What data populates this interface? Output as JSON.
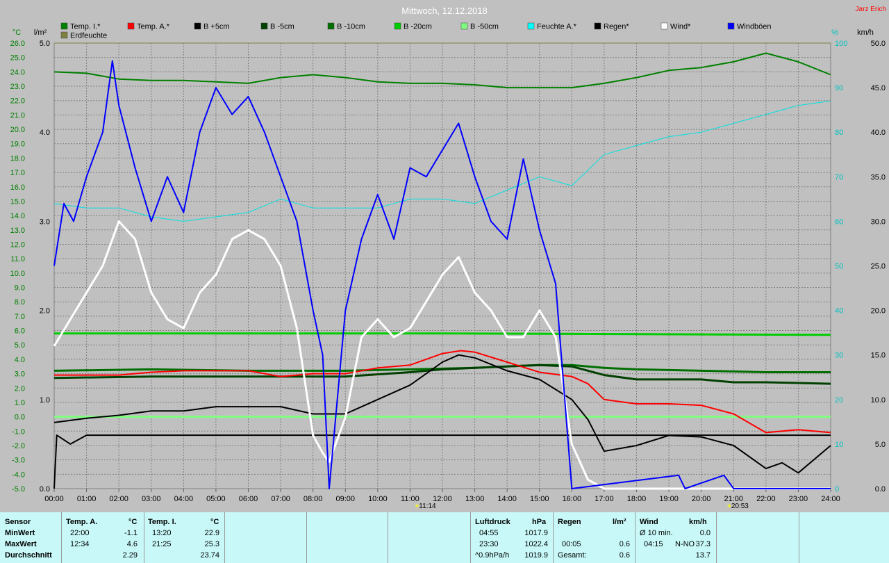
{
  "header": {
    "title": "Mittwoch, 12.12.2018",
    "author": "Jarz Erich"
  },
  "colors": {
    "temp_i": "#008000",
    "temp_a": "#ff0000",
    "b5": "#000000",
    "b_5": "#004000",
    "b_10": "#006f00",
    "b_20": "#00cc00",
    "b_50": "#80ff80",
    "feuchte": "#00e0e0",
    "regen": "#000000",
    "wind": "#ffffff",
    "windboeen": "#0000ff",
    "erdfeuchte": "#808040",
    "left_axis": "#008000",
    "right_axis": "#00c0c0",
    "grid": "#808080",
    "bg": "#c0c0c0"
  },
  "legend": [
    {
      "label": "Temp. I.*",
      "color": "#008000"
    },
    {
      "label": "Temp. A.*",
      "color": "#ff0000"
    },
    {
      "label": "B +5cm",
      "color": "#000000"
    },
    {
      "label": "B -5cm",
      "color": "#004000"
    },
    {
      "label": "B -10cm",
      "color": "#006f00"
    },
    {
      "label": "B -20cm",
      "color": "#00cc00"
    },
    {
      "label": "B -50cm",
      "color": "#80ff80"
    },
    {
      "label": "Feuchte A.*",
      "color": "#00ffff"
    },
    {
      "label": "Regen*",
      "color": "#000000"
    },
    {
      "label": "Wind*",
      "color": "#ffffff"
    },
    {
      "label": "Windböen",
      "color": "#0000ff"
    },
    {
      "label": "Erdfeuchte",
      "color": "#808040"
    }
  ],
  "axes": {
    "left_unit": "°C",
    "rain_unit": "l/m²",
    "hum_unit": "%",
    "wind_unit": "km/h",
    "temp_ticks": [
      "26.0",
      "25.0",
      "24.0",
      "23.0",
      "22.0",
      "21.0",
      "20.0",
      "19.0",
      "18.0",
      "17.0",
      "16.0",
      "15.0",
      "14.0",
      "13.0",
      "12.0",
      "11.0",
      "10.0",
      "9.0",
      "8.0",
      "7.0",
      "6.0",
      "5.0",
      "4.0",
      "3.0",
      "2.0",
      "1.0",
      "0.0",
      "-1.0",
      "-2.0",
      "-3.0",
      "-4.0",
      "-5.0"
    ],
    "rain_ticks": [
      "5.0",
      "4.0",
      "3.0",
      "2.0",
      "1.0",
      "0.0"
    ],
    "hum_ticks": [
      "100",
      "90",
      "80",
      "70",
      "60",
      "50",
      "40",
      "30",
      "20",
      "10",
      "0"
    ],
    "wind_ticks": [
      "50.0",
      "45.0",
      "40.0",
      "35.0",
      "30.0",
      "25.0",
      "20.0",
      "15.0",
      "10.0",
      "5.0",
      "0.0"
    ],
    "time_ticks": [
      "00:00",
      "01:00",
      "02:00",
      "03:00",
      "04:00",
      "05:00",
      "06:00",
      "07:00",
      "08:00",
      "09:00",
      "10:00",
      "11:00",
      "12:00",
      "13:00",
      "14:00",
      "15:00",
      "16:00",
      "17:00",
      "18:00",
      "19:00",
      "20:00",
      "21:00",
      "22:00",
      "23:00",
      "24:00"
    ],
    "sunrise": "11:14",
    "sunset": "20:53"
  },
  "chart_data": {
    "type": "line",
    "title": "Mittwoch, 12.12.2018",
    "x_range_hours": [
      0,
      24
    ],
    "ylim_temp": [
      -5,
      26
    ],
    "ylim_rain": [
      0,
      5
    ],
    "ylim_hum": [
      0,
      100
    ],
    "ylim_wind": [
      0,
      50
    ],
    "series": [
      {
        "name": "Temp. I.*",
        "axis": "temp",
        "points": [
          [
            0,
            24.0
          ],
          [
            1,
            23.9
          ],
          [
            2,
            23.5
          ],
          [
            3,
            23.4
          ],
          [
            4,
            23.4
          ],
          [
            5,
            23.3
          ],
          [
            6,
            23.2
          ],
          [
            7,
            23.6
          ],
          [
            8,
            23.8
          ],
          [
            9,
            23.6
          ],
          [
            10,
            23.3
          ],
          [
            11,
            23.2
          ],
          [
            12,
            23.2
          ],
          [
            13,
            23.1
          ],
          [
            14,
            22.9
          ],
          [
            15,
            22.9
          ],
          [
            16,
            22.9
          ],
          [
            17,
            23.2
          ],
          [
            18,
            23.6
          ],
          [
            19,
            24.1
          ],
          [
            20,
            24.3
          ],
          [
            21,
            24.7
          ],
          [
            22,
            25.3
          ],
          [
            23,
            24.7
          ],
          [
            24,
            23.8
          ]
        ]
      },
      {
        "name": "Temp. A.*",
        "axis": "temp",
        "points": [
          [
            0,
            2.9
          ],
          [
            1,
            2.9
          ],
          [
            2,
            2.9
          ],
          [
            3,
            3.1
          ],
          [
            4,
            3.2
          ],
          [
            5,
            3.2
          ],
          [
            6,
            3.2
          ],
          [
            7,
            2.8
          ],
          [
            8,
            3.0
          ],
          [
            9,
            3.0
          ],
          [
            10,
            3.4
          ],
          [
            11,
            3.6
          ],
          [
            12,
            4.4
          ],
          [
            12.57,
            4.6
          ],
          [
            13,
            4.5
          ],
          [
            14,
            3.8
          ],
          [
            15,
            3.1
          ],
          [
            16,
            2.8
          ],
          [
            16.5,
            2.3
          ],
          [
            17,
            1.2
          ],
          [
            18,
            0.9
          ],
          [
            19,
            0.9
          ],
          [
            20,
            0.8
          ],
          [
            21,
            0.2
          ],
          [
            22,
            -1.1
          ],
          [
            23,
            -0.9
          ],
          [
            24,
            -1.1
          ]
        ]
      },
      {
        "name": "B +5cm",
        "axis": "temp",
        "points": [
          [
            0,
            -0.4
          ],
          [
            1,
            -0.1
          ],
          [
            2,
            0.1
          ],
          [
            3,
            0.4
          ],
          [
            4,
            0.4
          ],
          [
            5,
            0.7
          ],
          [
            6,
            0.7
          ],
          [
            7,
            0.7
          ],
          [
            8,
            0.2
          ],
          [
            9,
            0.2
          ],
          [
            10,
            1.2
          ],
          [
            11,
            2.2
          ],
          [
            12,
            3.8
          ],
          [
            12.5,
            4.3
          ],
          [
            13,
            4.1
          ],
          [
            14,
            3.2
          ],
          [
            15,
            2.6
          ],
          [
            16,
            1.2
          ],
          [
            16.5,
            -0.2
          ],
          [
            17,
            -2.4
          ],
          [
            18,
            -2.0
          ],
          [
            19,
            -1.3
          ],
          [
            20,
            -1.4
          ],
          [
            21,
            -2.0
          ],
          [
            22,
            -3.6
          ],
          [
            22.5,
            -3.2
          ],
          [
            23,
            -3.9
          ],
          [
            24,
            -2.0
          ]
        ]
      },
      {
        "name": "B -5cm",
        "axis": "temp",
        "points": [
          [
            0,
            2.7
          ],
          [
            3,
            2.8
          ],
          [
            6,
            2.8
          ],
          [
            9,
            2.8
          ],
          [
            11,
            3.1
          ],
          [
            12,
            3.3
          ],
          [
            13,
            3.4
          ],
          [
            15,
            3.6
          ],
          [
            16,
            3.5
          ],
          [
            17,
            2.9
          ],
          [
            18,
            2.6
          ],
          [
            19,
            2.6
          ],
          [
            20,
            2.6
          ],
          [
            21,
            2.4
          ],
          [
            22,
            2.4
          ],
          [
            24,
            2.3
          ]
        ]
      },
      {
        "name": "B -10cm",
        "axis": "temp",
        "points": [
          [
            0,
            3.2
          ],
          [
            3,
            3.3
          ],
          [
            6,
            3.2
          ],
          [
            9,
            3.2
          ],
          [
            11,
            3.3
          ],
          [
            13,
            3.4
          ],
          [
            15,
            3.6
          ],
          [
            16,
            3.6
          ],
          [
            17,
            3.4
          ],
          [
            18,
            3.3
          ],
          [
            20,
            3.2
          ],
          [
            22,
            3.1
          ],
          [
            24,
            3.1
          ]
        ]
      },
      {
        "name": "B -20cm",
        "axis": "temp",
        "points": [
          [
            0,
            5.8
          ],
          [
            12,
            5.8
          ],
          [
            24,
            5.7
          ]
        ]
      },
      {
        "name": "B -50cm",
        "axis": "temp",
        "points": [
          [
            0,
            0.0
          ],
          [
            24,
            0.0
          ]
        ]
      },
      {
        "name": "Feuchte A.*",
        "axis": "hum",
        "points": [
          [
            0,
            64
          ],
          [
            1,
            63
          ],
          [
            2,
            63
          ],
          [
            3,
            61
          ],
          [
            4,
            60
          ],
          [
            5,
            61
          ],
          [
            6,
            62
          ],
          [
            7,
            65
          ],
          [
            8,
            63
          ],
          [
            9,
            63
          ],
          [
            10,
            63
          ],
          [
            11,
            65
          ],
          [
            12,
            65
          ],
          [
            13,
            64
          ],
          [
            14,
            67
          ],
          [
            15,
            70
          ],
          [
            16,
            68
          ],
          [
            17,
            75
          ],
          [
            18,
            77
          ],
          [
            19,
            79
          ],
          [
            20,
            80
          ],
          [
            21,
            82
          ],
          [
            22,
            84
          ],
          [
            23,
            86
          ],
          [
            24,
            87
          ]
        ]
      },
      {
        "name": "Regen*",
        "axis": "rain",
        "points": [
          [
            0,
            0.0
          ],
          [
            0.08,
            0.6
          ],
          [
            0.5,
            0.5
          ],
          [
            1,
            0.6
          ],
          [
            2,
            0.6
          ],
          [
            24,
            0.6
          ]
        ]
      },
      {
        "name": "Wind*",
        "axis": "wind",
        "points": [
          [
            0,
            16
          ],
          [
            0.5,
            19
          ],
          [
            1,
            22
          ],
          [
            1.5,
            25
          ],
          [
            2,
            30
          ],
          [
            2.5,
            28
          ],
          [
            3,
            22
          ],
          [
            3.5,
            19
          ],
          [
            4,
            18
          ],
          [
            4.5,
            22
          ],
          [
            5,
            24
          ],
          [
            5.5,
            28
          ],
          [
            6,
            29
          ],
          [
            6.5,
            28
          ],
          [
            7,
            25
          ],
          [
            7.5,
            18
          ],
          [
            8,
            6
          ],
          [
            8.3,
            4
          ],
          [
            8.5,
            3
          ],
          [
            9,
            8
          ],
          [
            9.5,
            17
          ],
          [
            10,
            19
          ],
          [
            10.5,
            17
          ],
          [
            11,
            18
          ],
          [
            11.5,
            21
          ],
          [
            12,
            24
          ],
          [
            12.5,
            26
          ],
          [
            13,
            22
          ],
          [
            13.5,
            20
          ],
          [
            14,
            17
          ],
          [
            14.5,
            17
          ],
          [
            15,
            20
          ],
          [
            15.5,
            17
          ],
          [
            16,
            5
          ],
          [
            16.5,
            1
          ],
          [
            17,
            0
          ],
          [
            24,
            0
          ]
        ]
      },
      {
        "name": "Windböen",
        "axis": "wind",
        "points": [
          [
            0,
            25
          ],
          [
            0.3,
            32
          ],
          [
            0.6,
            30
          ],
          [
            1,
            35
          ],
          [
            1.5,
            40
          ],
          [
            1.8,
            48
          ],
          [
            2,
            43
          ],
          [
            2.5,
            36
          ],
          [
            3,
            30
          ],
          [
            3.5,
            35
          ],
          [
            4,
            31
          ],
          [
            4.5,
            40
          ],
          [
            5,
            45
          ],
          [
            5.5,
            42
          ],
          [
            6,
            44
          ],
          [
            6.5,
            40
          ],
          [
            7,
            35
          ],
          [
            7.5,
            30
          ],
          [
            8,
            20
          ],
          [
            8.3,
            15
          ],
          [
            8.5,
            0
          ],
          [
            9,
            20
          ],
          [
            9.5,
            28
          ],
          [
            10,
            33
          ],
          [
            10.5,
            28
          ],
          [
            11,
            36
          ],
          [
            11.5,
            35
          ],
          [
            12,
            38
          ],
          [
            12.5,
            41
          ],
          [
            13,
            35
          ],
          [
            13.5,
            30
          ],
          [
            14,
            28
          ],
          [
            14.5,
            37
          ],
          [
            15,
            29
          ],
          [
            15.5,
            23
          ],
          [
            16,
            0
          ],
          [
            19.3,
            1.5
          ],
          [
            19.5,
            0
          ],
          [
            20.7,
            1.5
          ],
          [
            21,
            0
          ],
          [
            24,
            0
          ]
        ]
      },
      {
        "name": "Erdfeuchte",
        "axis": "hum",
        "points": [
          [
            0,
            100
          ],
          [
            24,
            100
          ]
        ]
      }
    ]
  },
  "stats": {
    "sensor": {
      "title": "Sensor",
      "min": "MinWert",
      "max": "MaxWert",
      "avg": "Durchschnitt"
    },
    "temp_a": {
      "title": "Temp. A.",
      "unit": "°C",
      "min_time": "22:00",
      "min_val": "-1.1",
      "max_time": "12:34",
      "max_val": "4.6",
      "avg": "2.29"
    },
    "temp_i": {
      "title": "Temp. I.",
      "unit": "°C",
      "min_time": "13:20",
      "min_val": "22.9",
      "max_time": "21:25",
      "max_val": "25.3",
      "avg": "23.74"
    },
    "pressure": {
      "title": "Luftdruck",
      "unit": "hPa",
      "min_time": "04:55",
      "min_val": "1017.9",
      "max_time": "23:30",
      "max_val": "1022.4",
      "avg_label": "^0.9hPa/h",
      "avg": "1019.9"
    },
    "rain": {
      "title": "Regen",
      "unit": "l/m²",
      "max_time": "00:05",
      "max_val": "0.6",
      "total_label": "Gesamt:",
      "total": "0.6"
    },
    "wind": {
      "title": "Wind",
      "unit": "km/h",
      "avg10_label": "Ø 10 min.",
      "avg10": "0.0",
      "max_time": "04:15",
      "max_dir": "N-NO",
      "max_val": "37.3",
      "avg": "13.7"
    }
  }
}
